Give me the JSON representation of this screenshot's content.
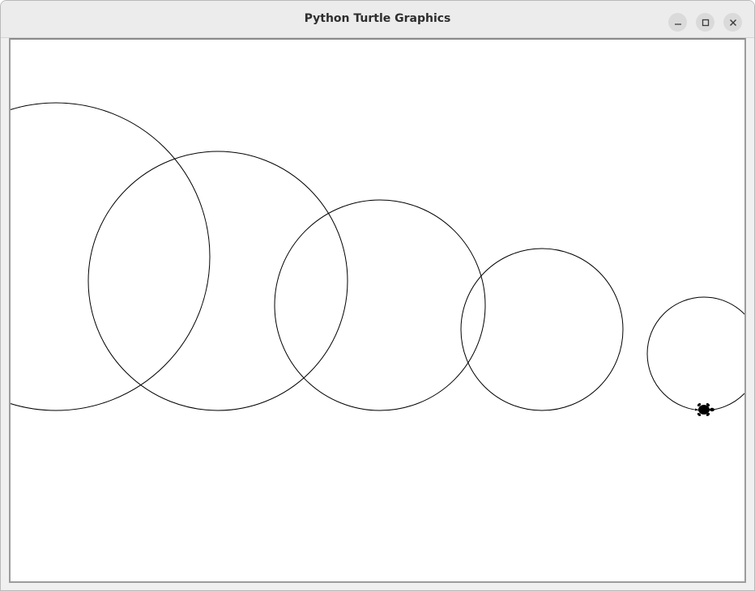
{
  "window": {
    "title": "Python Turtle Graphics"
  },
  "titlebar_buttons": [
    {
      "name": "minimize",
      "icon": "minimize-icon"
    },
    {
      "name": "maximize",
      "icon": "maximize-icon"
    },
    {
      "name": "close",
      "icon": "close-icon"
    }
  ],
  "canvas": {
    "background": "#ffffff",
    "stroke_color": "#000000",
    "turtle_icon": "turtle-icon"
  }
}
